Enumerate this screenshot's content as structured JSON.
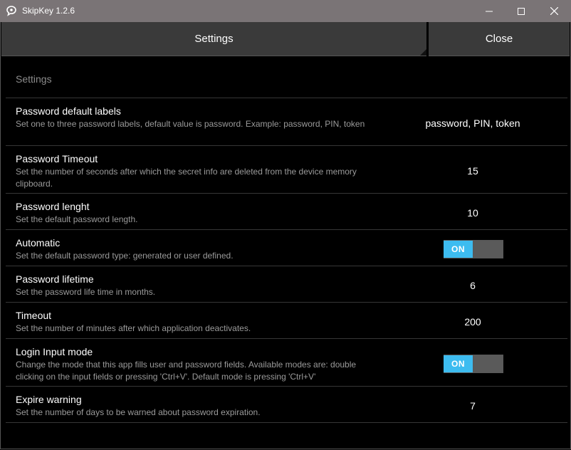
{
  "window": {
    "title": "SkipKey 1.2.6",
    "icon": "skipkey-logo-icon",
    "controls": [
      "minimize-icon",
      "maximize-icon",
      "close-icon"
    ]
  },
  "header": {
    "settings_label": "Settings",
    "close_label": "Close"
  },
  "section": {
    "title": "Settings"
  },
  "settings": [
    {
      "title": "Password default labels",
      "description": "Set one to three password labels, default value is password. Example: password, PIN, token",
      "value": "password, PIN, token",
      "kind": "text"
    },
    {
      "title": "Password Timeout",
      "description": "Set the number of seconds after which the secret info are deleted from the device memory clipboard.",
      "value": "15",
      "kind": "text"
    },
    {
      "title": "Password lenght",
      "description": "Set the default password length.",
      "value": "10",
      "kind": "text"
    },
    {
      "title": "Automatic",
      "description": "Set the default password type: generated or user defined.",
      "value": "ON",
      "kind": "toggle"
    },
    {
      "title": "Password lifetime",
      "description": "Set the password life time in months.",
      "value": "6",
      "kind": "text"
    },
    {
      "title": "Timeout",
      "description": "Set the number of minutes after which application deactivates.",
      "value": "200",
      "kind": "text"
    },
    {
      "title": "Login Input mode",
      "description": "Change the mode that this app fills user and password fields. Available modes are: double clicking on the input fields or pressing 'Ctrl+V'. Default mode is pressing 'Ctrl+V'",
      "value": "ON",
      "kind": "toggle"
    },
    {
      "title": "Expire warning",
      "description": "Set the number of days to be warned about password expiration.",
      "value": "7",
      "kind": "text"
    }
  ],
  "colors": {
    "titlebar": "#7a7476",
    "background": "#000000",
    "tab": "#3a3a3a",
    "toggle_on": "#3dbcf0",
    "toggle_off": "#585858",
    "description": "#9a9a9a",
    "divider": "#363636"
  }
}
